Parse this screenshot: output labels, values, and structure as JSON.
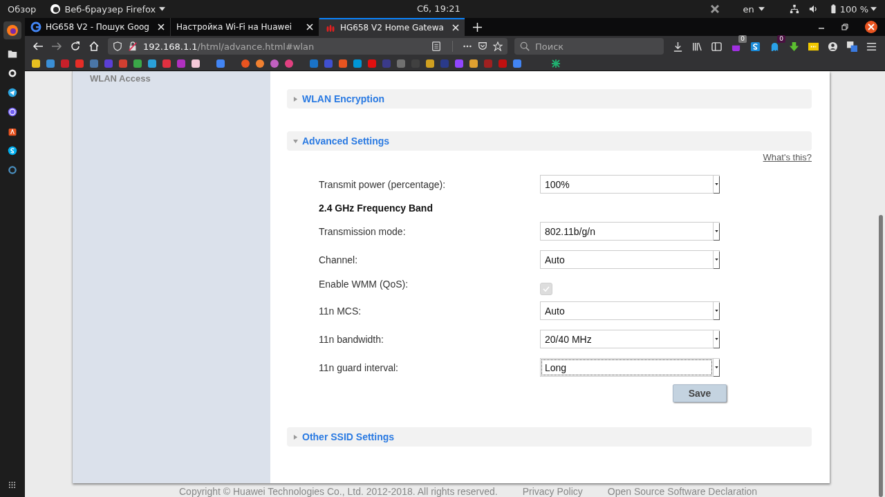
{
  "system_bar": {
    "activities": "Обзор",
    "app_menu": "Веб-браузер Firefox",
    "clock": "Сб, 19:21",
    "language": "en",
    "battery": "100 %"
  },
  "tabs": [
    {
      "title": "HG658 V2 - Пошук Goog",
      "selected": false
    },
    {
      "title": "Настройка Wi-Fi на Huawei",
      "selected": false
    },
    {
      "title": "HG658 V2 Home Gatewa",
      "selected": true
    }
  ],
  "address_bar": {
    "host": "192.168.1.1",
    "path": "/html/advance.html#wlan"
  },
  "search": {
    "placeholder": "Поиск"
  },
  "extension_badges": [
    "0",
    "0"
  ],
  "sidebar": {
    "heading": "WLAN Access"
  },
  "sections": [
    {
      "title": "WLAN Encryption",
      "expanded": false
    },
    {
      "title": "Advanced Settings",
      "expanded": true,
      "content": {
        "help_link": "What's this?",
        "fields": [
          {
            "kind": "select",
            "label": "Transmit power (percentage):",
            "value": "100%",
            "focused": false
          },
          {
            "kind": "heading",
            "label": "2.4 GHz Frequency Band"
          },
          {
            "kind": "select",
            "label": "Transmission mode:",
            "value": "802.11b/g/n",
            "focused": false
          },
          {
            "kind": "select",
            "label": "Channel:",
            "value": "Auto",
            "focused": false
          },
          {
            "kind": "checkbox",
            "label": "Enable WMM (QoS):",
            "checked": true,
            "disabled": true
          },
          {
            "kind": "select",
            "label": "11n MCS:",
            "value": "Auto",
            "focused": false
          },
          {
            "kind": "select",
            "label": "11n bandwidth:",
            "value": "20/40 MHz",
            "focused": false
          },
          {
            "kind": "select",
            "label": "11n guard interval:",
            "value": "Long",
            "focused": true
          }
        ],
        "save": "Save"
      }
    },
    {
      "title": "Other SSID Settings",
      "expanded": false
    }
  ],
  "footer": {
    "copyright": "Copyright © Huawei Technologies Co., Ltd. 2012-2018. All rights reserved.",
    "links": [
      "Privacy Policy",
      "Open Source Software Declaration"
    ]
  }
}
